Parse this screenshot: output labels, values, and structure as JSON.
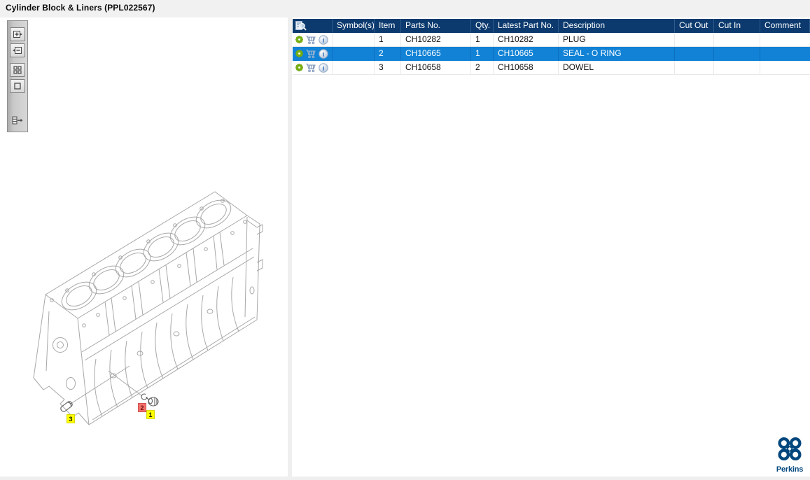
{
  "window": {
    "title": "Cylinder Block & Liners (PPL022567)"
  },
  "viewer": {
    "toolbar": [
      {
        "icon": "zoom-in-icon"
      },
      {
        "icon": "zoom-out-icon"
      },
      {
        "icon": "fit-view-icon"
      },
      {
        "icon": "actual-size-icon"
      },
      {
        "icon": "toggle-parts-list-icon"
      }
    ],
    "callouts": [
      {
        "number": "1",
        "style": "yellow"
      },
      {
        "number": "2",
        "style": "red"
      },
      {
        "number": "3",
        "style": "yellow"
      }
    ]
  },
  "table": {
    "header_icon": "image-preview-icon",
    "row_action_icons": [
      "gear-icon",
      "cart-icon",
      "info-icon"
    ],
    "columns": [
      "Symbol(s)",
      "Item",
      "Parts No.",
      "Qty.",
      "Latest Part No.",
      "Description",
      "Cut Out",
      "Cut In",
      "Comment"
    ],
    "rows": [
      {
        "item": "1",
        "parts_no": "CH10282",
        "qty": "1",
        "latest_part_no": "CH10282",
        "description": "PLUG",
        "cut_out": "",
        "cut_in": "",
        "comment": ""
      },
      {
        "item": "2",
        "parts_no": "CH10665",
        "qty": "1",
        "latest_part_no": "CH10665",
        "description": "SEAL - O RING",
        "cut_out": "",
        "cut_in": "",
        "comment": ""
      },
      {
        "item": "3",
        "parts_no": "CH10658",
        "qty": "2",
        "latest_part_no": "CH10658",
        "description": "DOWEL",
        "cut_out": "",
        "cut_in": "",
        "comment": ""
      }
    ],
    "selected_row_index": 1
  },
  "branding": {
    "logo_text": "Perkins"
  },
  "colors": {
    "header_bg": "#0C3A6E",
    "selected_row_bg": "#1182D5",
    "gear_green": "#7DB713",
    "cart_blue": "#7E97BB",
    "callout_yellow": "#FFFF00",
    "callout_red": "#F4716B",
    "logo_blue": "#00477D",
    "drawing_line": "#A8A8A8"
  }
}
